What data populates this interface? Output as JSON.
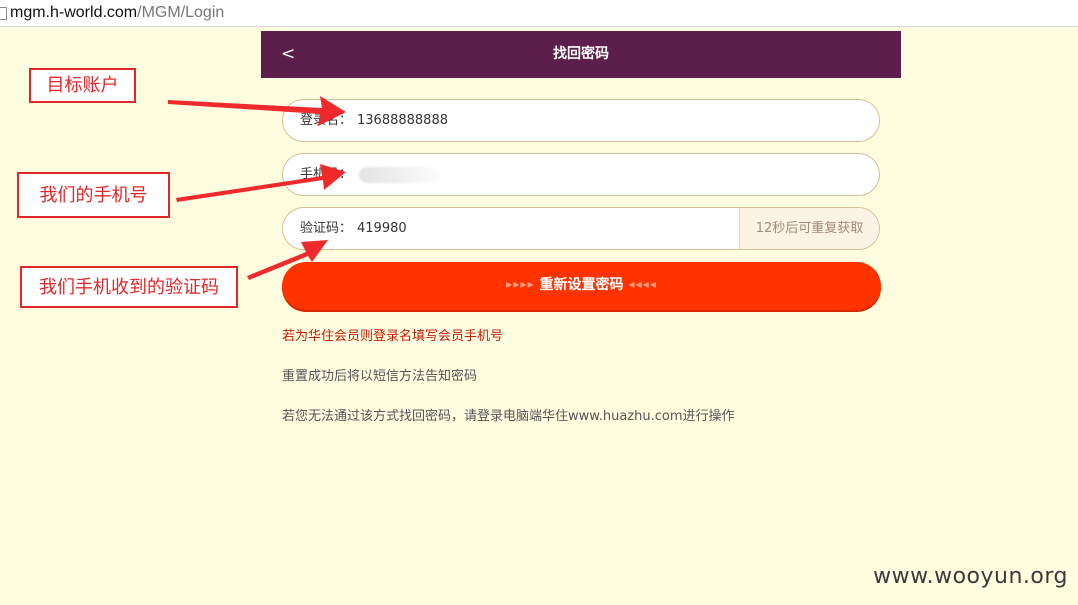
{
  "browser": {
    "url_host": "mgm.h-world.com",
    "url_path": "/MGM/Login"
  },
  "header": {
    "back_label": "<",
    "title": "找回密码"
  },
  "form": {
    "login_label": "登录名：",
    "login_value": "13688888888",
    "phone_label": "手机号：",
    "code_label": "验证码：",
    "code_value": "419980",
    "resend_label": "12秒后可重复获取",
    "submit_label": "重新设置密码",
    "submit_chevrons_left": "▶▶▶▶",
    "submit_chevrons_right": "◀◀◀◀"
  },
  "notes": {
    "member_hint": "若为华住会员则登录名填写会员手机号",
    "sms_hint": "重置成功后将以短信方法告知密码",
    "fallback_hint": "若您无法通过该方式找回密码，请登录电脑端华住www.huazhu.com进行操作"
  },
  "annotations": {
    "target_account": "目标账户",
    "our_phone": "我们的手机号",
    "our_code": "我们手机收到的验证码"
  },
  "watermark": "www.wooyun.org",
  "colors": {
    "page_background": "#fffde0",
    "header_background": "#5c1f4c",
    "submit_background": "#ff3300",
    "member_hint": "#c0200a",
    "annotation_red": "#e0282b"
  }
}
